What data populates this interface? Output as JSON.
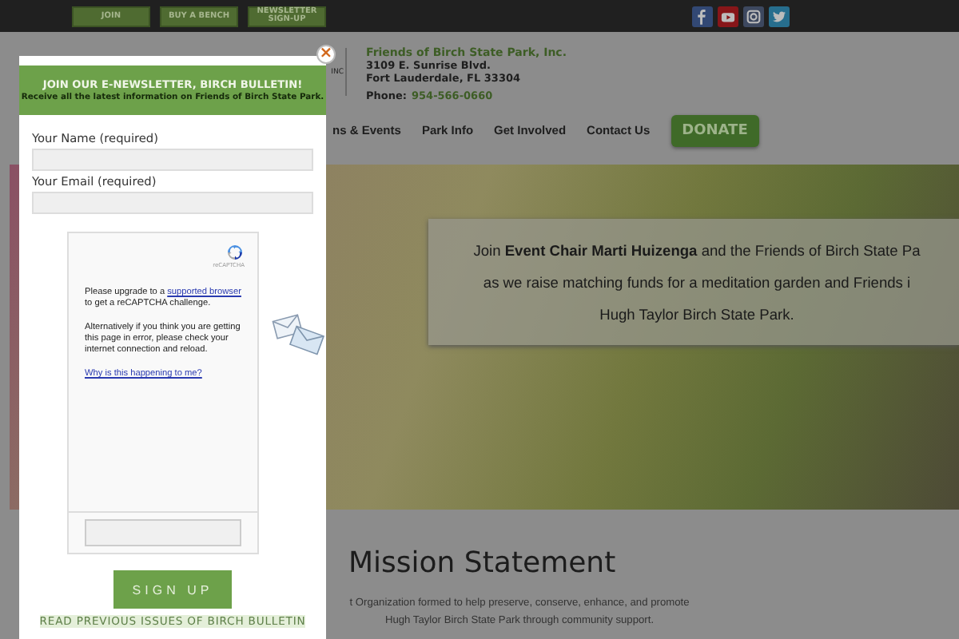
{
  "top_bar": {
    "buttons": [
      "JOIN",
      "BUY A BENCH",
      "NEWSLETTER SIGN-UP"
    ]
  },
  "header": {
    "logo_suffix": "INC",
    "org_name": "Friends of Birch State Park, Inc.",
    "address_lines": [
      "3109 E. Sunrise Blvd.",
      "Fort Lauderdale, FL  33304"
    ],
    "phone_label": "Phone:",
    "phone": "954-566-0660"
  },
  "nav": {
    "items": [
      "ns & Events",
      "Park Info",
      "Get Involved",
      "Contact Us"
    ],
    "donate": "DONATE"
  },
  "hero": {
    "lines": [
      "Join **Event Chair Marti Huizenga** and the Friends of Birch State Pa",
      "as we raise matching funds for a meditation garden and Friends i",
      "Hugh Taylor Birch State Park."
    ]
  },
  "mission": {
    "title": "Mission Statement",
    "text": "t Organization formed to help preserve, conserve, enhance, and promote Hugh Taylor Birch State Park through community support."
  },
  "modal": {
    "close": "×",
    "title": "JOIN OUR E-NEWSLETTER, BIRCH BULLETIN!",
    "subtitle": "Receive all the latest information on Friends of Birch State Park.",
    "fields": [
      {
        "label": "Your Name (required)"
      },
      {
        "label": "Your Email (required)"
      }
    ],
    "captcha": {
      "brand": "reCAPTCHA",
      "text_before": "Please upgrade to a",
      "link": "supported browser",
      "text_after": "to get a reCAPTCHA challenge.",
      "alt_text": "Alternatively if you think you are getting this page in error, please check your internet connection and reload.",
      "why_link": "Why is this happening to me?"
    },
    "submit": "SIGN UP",
    "archive_link": "READ PREVIOUS ISSUES OF  BIRCH BULLETIN"
  }
}
